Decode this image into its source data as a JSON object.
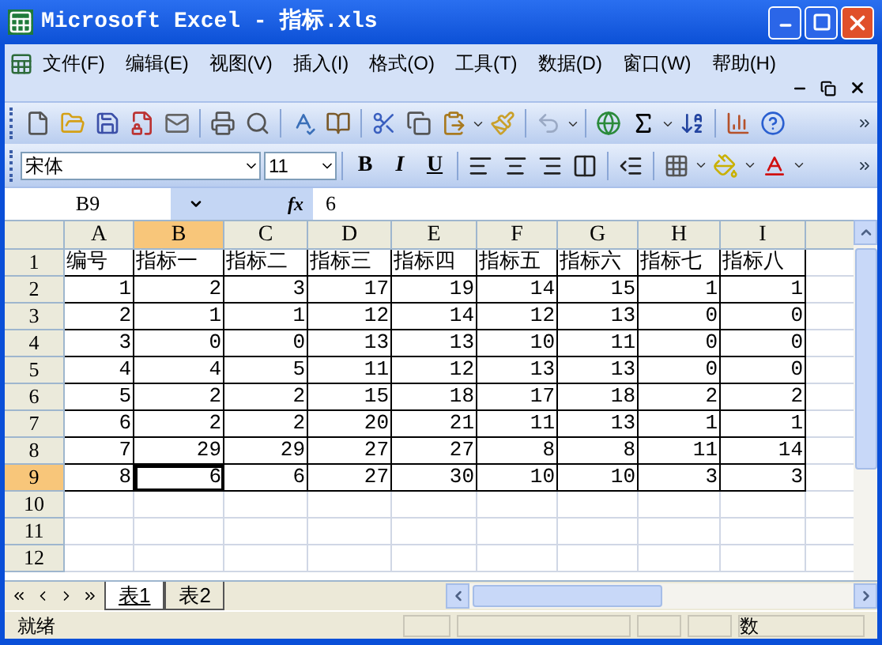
{
  "window": {
    "title": "Microsoft Excel - 指标.xls"
  },
  "menu": [
    {
      "label": "文件(F)"
    },
    {
      "label": "编辑(E)"
    },
    {
      "label": "视图(V)"
    },
    {
      "label": "插入(I)"
    },
    {
      "label": "格式(O)"
    },
    {
      "label": "工具(T)"
    },
    {
      "label": "数据(D)"
    },
    {
      "label": "窗口(W)"
    },
    {
      "label": "帮助(H)"
    }
  ],
  "format_toolbar": {
    "font": "宋体",
    "size": "11",
    "bold": "B",
    "italic": "I",
    "underline": "U"
  },
  "formula_bar": {
    "name_box": "B9",
    "fx": "fx",
    "value": "6"
  },
  "columns": [
    {
      "label": "A",
      "selected": false
    },
    {
      "label": "B",
      "selected": true
    },
    {
      "label": "C",
      "selected": false
    },
    {
      "label": "D",
      "selected": false
    },
    {
      "label": "E",
      "selected": false
    },
    {
      "label": "F",
      "selected": false
    },
    {
      "label": "G",
      "selected": false
    },
    {
      "label": "H",
      "selected": false
    },
    {
      "label": "I",
      "selected": false
    }
  ],
  "rows": [
    {
      "label": "1",
      "selected": false,
      "cells": [
        "编号",
        "指标一",
        "指标二",
        "指标三",
        "指标四",
        "指标五",
        "指标六",
        "指标七",
        "指标八"
      ]
    },
    {
      "label": "2",
      "selected": false,
      "cells": [
        "1",
        "2",
        "3",
        "17",
        "19",
        "14",
        "15",
        "1",
        "1"
      ]
    },
    {
      "label": "3",
      "selected": false,
      "cells": [
        "2",
        "1",
        "1",
        "12",
        "14",
        "12",
        "13",
        "0",
        "0"
      ]
    },
    {
      "label": "4",
      "selected": false,
      "cells": [
        "3",
        "0",
        "0",
        "13",
        "13",
        "10",
        "11",
        "0",
        "0"
      ]
    },
    {
      "label": "5",
      "selected": false,
      "cells": [
        "4",
        "4",
        "5",
        "11",
        "12",
        "13",
        "13",
        "0",
        "0"
      ]
    },
    {
      "label": "6",
      "selected": false,
      "cells": [
        "5",
        "2",
        "2",
        "15",
        "18",
        "17",
        "18",
        "2",
        "2"
      ]
    },
    {
      "label": "7",
      "selected": false,
      "cells": [
        "6",
        "2",
        "2",
        "20",
        "21",
        "11",
        "13",
        "1",
        "1"
      ]
    },
    {
      "label": "8",
      "selected": false,
      "cells": [
        "7",
        "29",
        "29",
        "27",
        "27",
        "8",
        "8",
        "11",
        "14"
      ]
    },
    {
      "label": "9",
      "selected": true,
      "cells": [
        "8",
        "6",
        "6",
        "27",
        "30",
        "10",
        "10",
        "3",
        "3"
      ]
    },
    {
      "label": "10",
      "selected": false
    },
    {
      "label": "11",
      "selected": false
    },
    {
      "label": "12",
      "selected": false
    }
  ],
  "sheet_tabs": [
    {
      "label": "表1",
      "selected": true
    },
    {
      "label": "表2",
      "selected": false
    }
  ],
  "status_bar": {
    "text": "就绪",
    "mode": "数"
  }
}
